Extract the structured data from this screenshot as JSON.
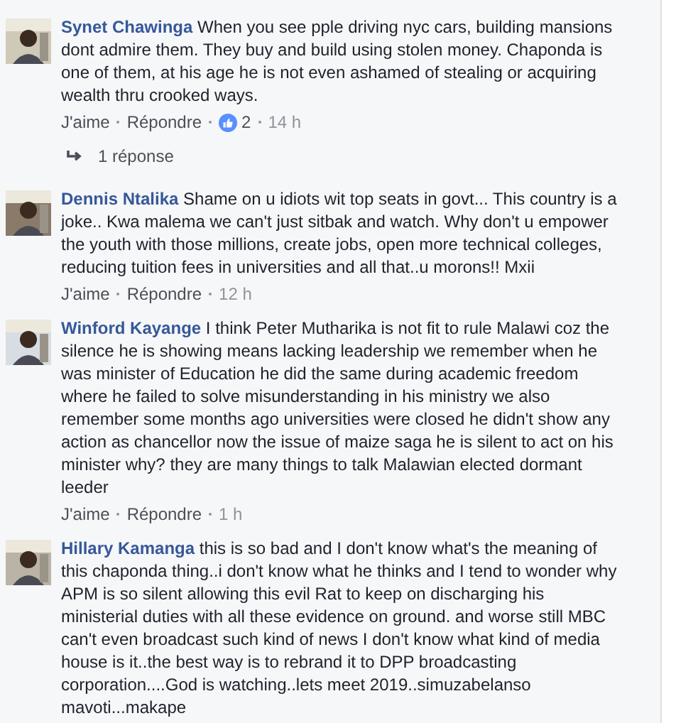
{
  "comments": [
    {
      "author": "Synet Chawinga",
      "text": "When you see pple driving nyc cars, building mansions dont admire them. They buy and build using stolen money. Chaponda is one of them, at his age he is not even ashamed of stealing or acquiring wealth thru crooked ways.",
      "like": "J'aime",
      "reply": "Répondre",
      "reactions": "2",
      "time": "14 h",
      "replies": "1 réponse"
    },
    {
      "author": "Dennis Ntalika",
      "text": "Shame on u idiots wit top seats in govt... This country is a joke.. Kwa malema we can't just sitbak and watch. Why don't u empower the youth with those millions, create jobs, open more technical colleges, reducing tuition fees in universities and all that..u morons!! Mxii",
      "like": "J'aime",
      "reply": "Répondre",
      "time": "12 h"
    },
    {
      "author": "Winford Kayange",
      "text": "I think Peter Mutharika is not fit to rule Malawi coz the silence he is showing means lacking leadership we remember when he was minister of Education he did the same during academic freedom where he failed to solve misunderstanding in his ministry we also remember some months ago universities were closed he didn't show any action as chancellor now the issue of maize saga he is silent to act on his minister why? they are many things to talk Malawian elected dormant leeder",
      "like": "J'aime",
      "reply": "Répondre",
      "time": "1 h"
    },
    {
      "author": "Hillary Kamanga",
      "text": "this is so bad and I don't know what's the meaning of this chaponda thing..i don't know what he thinks and I tend to wonder why APM is so silent allowing this evil Rat to keep on discharging his ministerial duties with all these evidence on ground. and worse still MBC can't even broadcast such kind of news I don't know what kind of media house is it..the best way is to rebrand it to DPP broadcasting corporation....God is watching..lets meet 2019..simuzabelanso mavoti...makape"
    }
  ]
}
